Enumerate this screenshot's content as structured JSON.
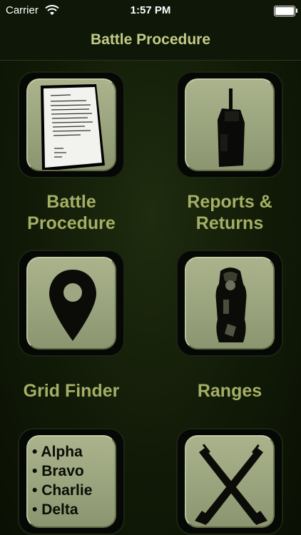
{
  "status_bar": {
    "carrier": "Carrier",
    "time": "1:57 PM"
  },
  "nav": {
    "title": "Battle Procedure"
  },
  "tiles": [
    {
      "label_line1": "Battle",
      "label_line2": "Procedure",
      "icon": "document-icon"
    },
    {
      "label_line1": "Reports &",
      "label_line2": "Returns",
      "icon": "radio-icon"
    },
    {
      "label": "Grid Finder",
      "icon": "map-pin-icon"
    },
    {
      "label": "Ranges",
      "icon": "soldier-target-icon"
    },
    {
      "items": [
        "Alpha",
        "Bravo",
        "Charlie",
        "Delta"
      ],
      "icon": "phonetic-list-icon"
    },
    {
      "icon": "crossed-rifles-icon"
    }
  ]
}
